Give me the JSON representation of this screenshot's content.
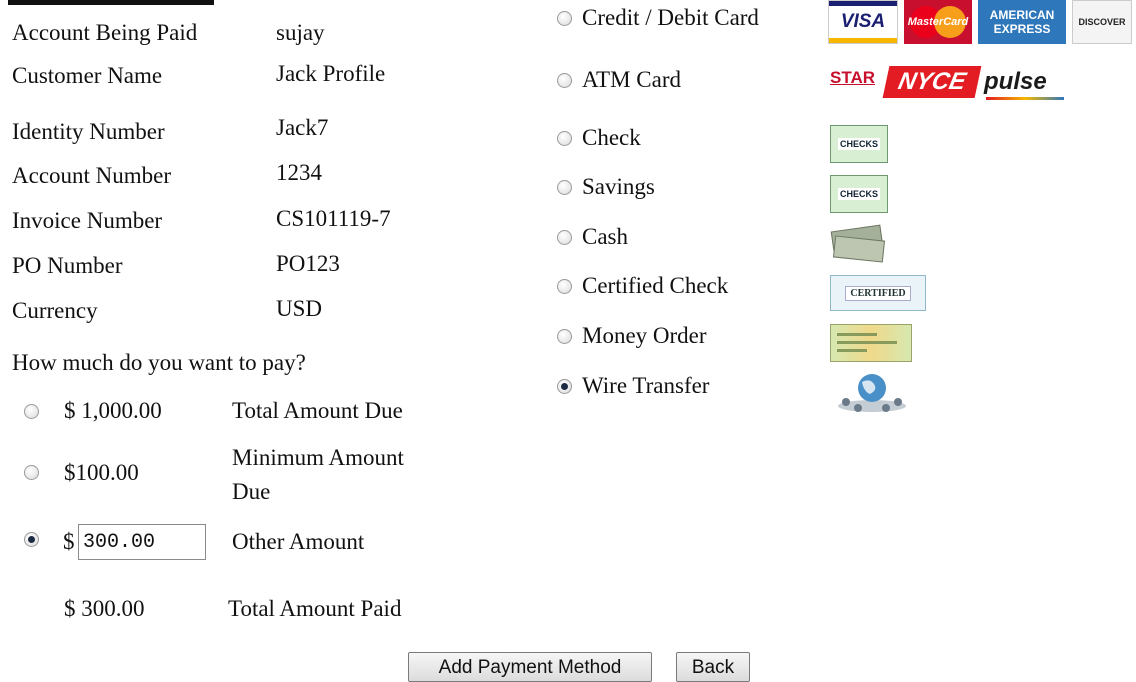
{
  "account": {
    "rows": [
      {
        "label": "Account Being Paid",
        "value": "sujay"
      },
      {
        "label": "Customer Name",
        "value": "Jack Profile"
      },
      {
        "label": "Identity Number",
        "value": "Jack7"
      },
      {
        "label": "Account Number",
        "value": "1234"
      },
      {
        "label": "Invoice Number",
        "value": "CS101119-7"
      },
      {
        "label": "PO Number",
        "value": "PO123"
      },
      {
        "label": "Currency",
        "value": "USD"
      }
    ]
  },
  "pay": {
    "question": "How much do you want to pay?",
    "options": [
      {
        "amount": "$ 1,000.00",
        "desc": "Total Amount Due",
        "selected": false
      },
      {
        "amount": "$100.00",
        "desc_line1": "Minimum Amount",
        "desc_line2": "Due",
        "selected": false
      },
      {
        "currency_symbol": "$",
        "input_value": "300.00",
        "desc": "Other Amount",
        "selected": true
      }
    ],
    "total_paid_amount": "$ 300.00",
    "total_paid_label": "Total Amount Paid"
  },
  "payment_methods": [
    {
      "label": "Credit / Debit Card",
      "icon": "credit-card-logos",
      "selected": false
    },
    {
      "label": "ATM Card",
      "icon": "atm-network-logos",
      "selected": false
    },
    {
      "label": "Check",
      "icon": "checks-icon",
      "selected": false
    },
    {
      "label": "Savings",
      "icon": "checks-icon",
      "selected": false
    },
    {
      "label": "Cash",
      "icon": "cash-icon",
      "selected": false
    },
    {
      "label": "Certified Check",
      "icon": "certified-check-icon",
      "selected": false
    },
    {
      "label": "Money Order",
      "icon": "money-order-icon",
      "selected": false
    },
    {
      "label": "Wire Transfer",
      "icon": "globe-network-icon",
      "selected": true
    }
  ],
  "logos": {
    "visa": "VISA",
    "mastercard": "MasterCard",
    "amex_line1": "AMERICAN",
    "amex_line2": "EXPRESS",
    "discover": "DISCOVER",
    "star": "STAR",
    "nyce": "NYCE",
    "pulse": "pulse",
    "checks": "CHECKS",
    "certified": "CERTIFIED"
  },
  "buttons": {
    "add_payment": "Add Payment Method",
    "back": "Back"
  },
  "colors": {
    "visa_blue": "#1a1f71",
    "visa_gold": "#f7b600",
    "mc_red": "#eb001b",
    "mc_orange": "#f79e1b",
    "amex_blue": "#2e77bb",
    "nyce_red": "#e31b23",
    "star_red": "#c8102e",
    "pulse_dark": "#1b1b1b"
  }
}
